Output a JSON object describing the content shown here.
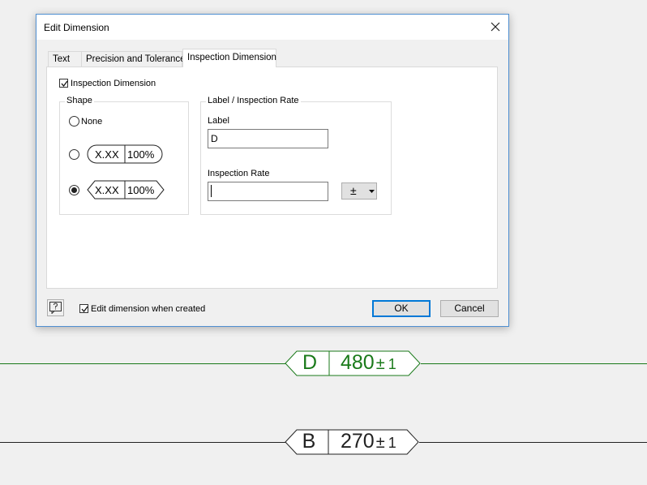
{
  "dialog": {
    "title": "Edit Dimension",
    "tabs": [
      {
        "label": "Text"
      },
      {
        "label": "Precision and Tolerance"
      },
      {
        "label": "Inspection Dimension"
      }
    ],
    "inspection_checkbox_label": "Inspection Dimension",
    "inspection_checked": true,
    "shape": {
      "group_label": "Shape",
      "none_label": "None",
      "option_text": "X.XX",
      "option_rate": "100%",
      "selected": "pointed"
    },
    "label_group": {
      "group_label": "Label / Inspection Rate",
      "label_caption": "Label",
      "label_value": "D",
      "rate_caption": "Inspection Rate",
      "rate_value": "",
      "tolerance_symbol": "±"
    },
    "footer": {
      "edit_when_created_label": "Edit dimension when created",
      "edit_when_created_checked": true,
      "ok_label": "OK",
      "cancel_label": "Cancel"
    }
  },
  "canvas": {
    "dim1": {
      "label": "D",
      "value": "480",
      "tol_symbol": "±",
      "tol": "1",
      "color": "#1a7a1a"
    },
    "dim2": {
      "label": "B",
      "value": "270",
      "tol_symbol": "±",
      "tol": "1",
      "color": "#222222"
    }
  }
}
